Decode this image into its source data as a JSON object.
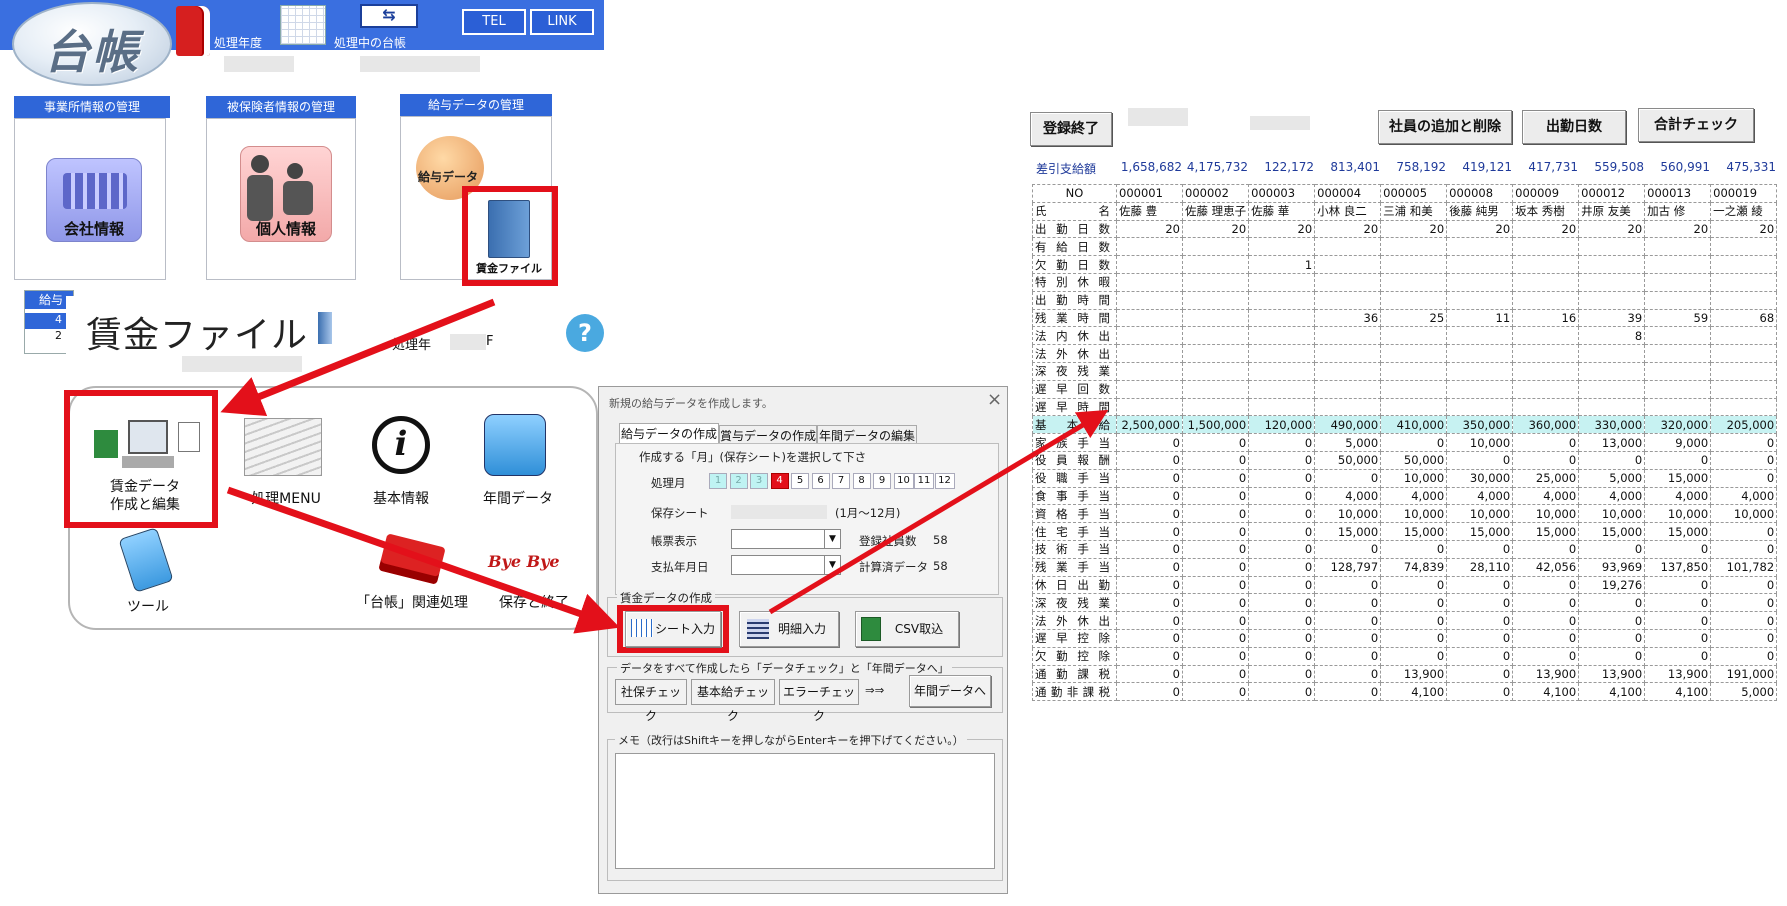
{
  "header": {
    "logo_text": "台帳",
    "processing_year_label": "処理年度",
    "current_ledger_label": "処理中の台帳",
    "tel_button": "TEL",
    "link_button": "LINK"
  },
  "sections": {
    "office": {
      "title": "事業所情報の管理",
      "label": "会社情報"
    },
    "insured": {
      "title": "被保険者情報の管理",
      "label": "個人情報"
    },
    "salary": {
      "title": "給与データの管理",
      "icon_text": "給与データ",
      "file_label": "賃金ファイル"
    },
    "partial_tab": "給与",
    "partial_row1": "4",
    "partial_row2": "2"
  },
  "wage_file": {
    "title": "賃金ファイル",
    "year_label": "処理年",
    "year_suffix": "F",
    "help": "?",
    "menu": {
      "create_edit_line1": "賃金データ",
      "create_edit_line2": "作成と編集",
      "processing_menu": "処理MENU",
      "basic_info": "基本情報",
      "annual_data": "年間データ",
      "tools": "ツール",
      "ledger_related": "「台帳」関連処理",
      "bye_bye": "Bye Bye",
      "save_and_exit": "保存と終了"
    }
  },
  "dialog": {
    "title": "新規の給与データを作成します。",
    "close": "×",
    "tabs": [
      "給与データの作成",
      "賞与データの作成",
      "年間データの編集"
    ],
    "instruction": "作成する「月」(保存シート)を選択して下さ",
    "month_label": "処理月",
    "months": [
      "1",
      "2",
      "3",
      "4",
      "5",
      "6",
      "7",
      "8",
      "9",
      "10",
      "11",
      "12"
    ],
    "selected_month": "4",
    "save_sheet_label": "保存シート",
    "save_sheet_hint": "(1月〜12月)",
    "form_display_label": "帳票表示",
    "employees_label": "登録社員数",
    "employees_value": "58",
    "pay_date_label": "支払年月日",
    "calculated_label": "計算済データ",
    "calculated_value": "58",
    "group_creation": "賃金データの作成",
    "sheet_input": "シート入力",
    "detail_input": "明細入力",
    "csv_import": "CSV取込",
    "group_check": "データをすべて作成したら「データチェック」と「年間データへ」",
    "social_check": "社保チェック",
    "basic_pay_check": "基本給チェック",
    "error_check": "エラーチェック",
    "arrows": "⇒⇒",
    "to_annual": "年間データへ",
    "memo_label": "メモ（改行はShiftキーを押しながらEnterキーを押下げてください。）"
  },
  "sheet": {
    "finish_button": "登録終了",
    "add_remove_button": "社員の追加と削除",
    "attendance_button": "出勤日数",
    "total_check_button": "合計チェック",
    "net_pay_label": "差引支給額",
    "net_pay": [
      "1,658,682",
      "4,175,732",
      "122,172",
      "813,401",
      "758,192",
      "419,121",
      "417,731",
      "559,508",
      "560,991",
      "475,331"
    ],
    "no_label": "NO",
    "name_label": "氏　　名",
    "employee_nos": [
      "000001",
      "000002",
      "000003",
      "000004",
      "000005",
      "000008",
      "000009",
      "000012",
      "000013",
      "000019"
    ],
    "names": [
      "佐藤 豊",
      "佐藤 理恵子",
      "佐藤 華",
      "小林 良二",
      "三浦 和美",
      "後藤 純男",
      "坂本 秀樹",
      "井原 友美",
      "加古 修",
      "一之瀬 綾"
    ],
    "rows": [
      {
        "label": "出勤日数",
        "values": [
          "20",
          "20",
          "20",
          "20",
          "20",
          "20",
          "20",
          "20",
          "20",
          "20"
        ]
      },
      {
        "label": "有給日数",
        "values": [
          "",
          "",
          "",
          "",
          "",
          "",
          "",
          "",
          "",
          ""
        ]
      },
      {
        "label": "欠勤日数",
        "values": [
          "",
          "",
          "1",
          "",
          "",
          "",
          "",
          "",
          "",
          ""
        ]
      },
      {
        "label": "特別休暇",
        "values": [
          "",
          "",
          "",
          "",
          "",
          "",
          "",
          "",
          "",
          ""
        ]
      },
      {
        "label": "出勤時間",
        "values": [
          "",
          "",
          "",
          "",
          "",
          "",
          "",
          "",
          "",
          ""
        ]
      },
      {
        "label": "残業時間",
        "values": [
          "",
          "",
          "",
          "36",
          "25",
          "11",
          "16",
          "39",
          "59",
          "68"
        ]
      },
      {
        "label": "法内休出",
        "values": [
          "",
          "",
          "",
          "",
          "",
          "",
          "",
          "8",
          "",
          ""
        ]
      },
      {
        "label": "法外休出",
        "values": [
          "",
          "",
          "",
          "",
          "",
          "",
          "",
          "",
          "",
          ""
        ]
      },
      {
        "label": "深夜残業",
        "values": [
          "",
          "",
          "",
          "",
          "",
          "",
          "",
          "",
          "",
          ""
        ]
      },
      {
        "label": "遅早回数",
        "values": [
          "",
          "",
          "",
          "",
          "",
          "",
          "",
          "",
          "",
          ""
        ]
      },
      {
        "label": "遅早時間",
        "values": [
          "",
          "",
          "",
          "",
          "",
          "",
          "",
          "",
          "",
          ""
        ]
      },
      {
        "label": "基本給",
        "values": [
          "2,500,000",
          "1,500,000",
          "120,000",
          "490,000",
          "410,000",
          "350,000",
          "360,000",
          "330,000",
          "320,000",
          "205,000"
        ],
        "highlight": true
      },
      {
        "label": "家族手当",
        "values": [
          "0",
          "0",
          "0",
          "5,000",
          "0",
          "10,000",
          "0",
          "13,000",
          "9,000",
          "0"
        ]
      },
      {
        "label": "役員報酬",
        "values": [
          "0",
          "0",
          "0",
          "50,000",
          "50,000",
          "0",
          "0",
          "0",
          "0",
          "0"
        ]
      },
      {
        "label": "役職手当",
        "values": [
          "0",
          "0",
          "0",
          "0",
          "10,000",
          "30,000",
          "25,000",
          "5,000",
          "15,000",
          "0"
        ]
      },
      {
        "label": "食事手当",
        "values": [
          "0",
          "0",
          "0",
          "4,000",
          "4,000",
          "4,000",
          "4,000",
          "4,000",
          "4,000",
          "4,000"
        ]
      },
      {
        "label": "資格手当",
        "values": [
          "0",
          "0",
          "0",
          "10,000",
          "10,000",
          "10,000",
          "10,000",
          "10,000",
          "10,000",
          "10,000"
        ]
      },
      {
        "label": "住宅手当",
        "values": [
          "0",
          "0",
          "0",
          "15,000",
          "15,000",
          "15,000",
          "15,000",
          "15,000",
          "15,000",
          "0"
        ]
      },
      {
        "label": "技術手当",
        "values": [
          "0",
          "0",
          "0",
          "0",
          "0",
          "0",
          "0",
          "0",
          "0",
          "0"
        ]
      },
      {
        "label": "残業手当",
        "values": [
          "0",
          "0",
          "0",
          "128,797",
          "74,839",
          "28,110",
          "42,056",
          "93,969",
          "137,850",
          "101,782"
        ]
      },
      {
        "label": "休日出勤",
        "values": [
          "0",
          "0",
          "0",
          "0",
          "0",
          "0",
          "0",
          "19,276",
          "0",
          "0"
        ]
      },
      {
        "label": "深夜残業",
        "values": [
          "0",
          "0",
          "0",
          "0",
          "0",
          "0",
          "0",
          "0",
          "0",
          "0"
        ]
      },
      {
        "label": "法外休出",
        "values": [
          "0",
          "0",
          "0",
          "0",
          "0",
          "0",
          "0",
          "0",
          "0",
          "0"
        ]
      },
      {
        "label": "遅早控除",
        "values": [
          "0",
          "0",
          "0",
          "0",
          "0",
          "0",
          "0",
          "0",
          "0",
          "0"
        ]
      },
      {
        "label": "欠勤控除",
        "values": [
          "0",
          "0",
          "0",
          "0",
          "0",
          "0",
          "0",
          "0",
          "0",
          "0"
        ]
      },
      {
        "label": "通勤課税",
        "values": [
          "0",
          "0",
          "0",
          "0",
          "13,900",
          "0",
          "13,900",
          "13,900",
          "13,900",
          "191,000"
        ]
      },
      {
        "label": "通勤非課税",
        "values": [
          "0",
          "0",
          "0",
          "0",
          "4,100",
          "0",
          "4,100",
          "4,100",
          "4,100",
          "5,000"
        ]
      }
    ]
  },
  "colors": {
    "accent_blue": "#3a6fe0",
    "highlight_red": "#e3101a",
    "sheet_highlight": "#c7f2f2"
  }
}
